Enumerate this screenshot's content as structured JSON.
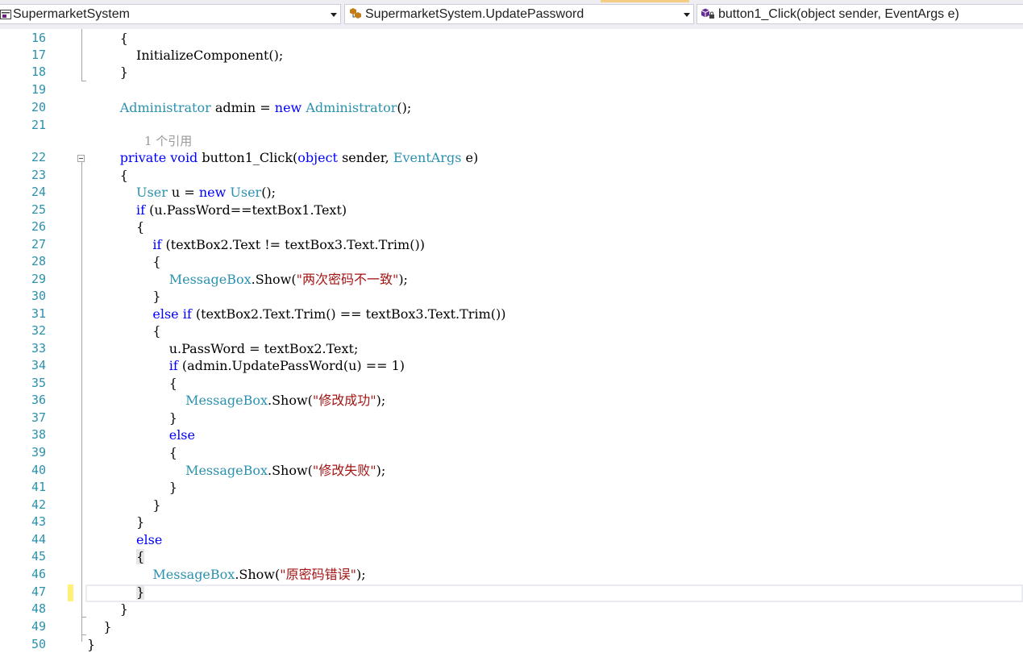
{
  "navbar": {
    "project": "SupermarketSystem",
    "class": "SupermarketSystem.UpdatePassword",
    "member": "button1_Click(object sender, EventArgs e)"
  },
  "icons": [
    "csharp-project-icon",
    "class-icon",
    "method-icon",
    "dropdown-arrow-icon"
  ],
  "colors": {
    "keyword": "#0000ff",
    "type": "#2b91af",
    "string": "#a31515",
    "line_number": "#2b91af",
    "code_lens": "#999999",
    "change_marker": "#fff176"
  },
  "code_lens": "1 个引用",
  "lines": [
    {
      "num": "16",
      "tokens": [
        {
          "t": "        {"
        }
      ]
    },
    {
      "num": "17",
      "tokens": [
        {
          "t": "            InitializeComponent();"
        }
      ]
    },
    {
      "num": "18",
      "tokens": [
        {
          "t": "        }"
        }
      ]
    },
    {
      "num": "19",
      "tokens": []
    },
    {
      "num": "20",
      "tokens": [
        {
          "t": "        "
        },
        {
          "t": "Administrator",
          "c": "ty"
        },
        {
          "t": " admin = "
        },
        {
          "t": "new",
          "c": "kw"
        },
        {
          "t": " "
        },
        {
          "t": "Administrator",
          "c": "ty"
        },
        {
          "t": "();"
        }
      ]
    },
    {
      "num": "21",
      "tokens": []
    },
    {
      "num": "22",
      "tokens": [
        {
          "t": "        "
        },
        {
          "t": "private",
          "c": "kw"
        },
        {
          "t": " "
        },
        {
          "t": "void",
          "c": "kw"
        },
        {
          "t": " button1_Click("
        },
        {
          "t": "object",
          "c": "kw"
        },
        {
          "t": " sender, "
        },
        {
          "t": "EventArgs",
          "c": "ty"
        },
        {
          "t": " e)"
        }
      ]
    },
    {
      "num": "23",
      "tokens": [
        {
          "t": "        {"
        }
      ]
    },
    {
      "num": "24",
      "tokens": [
        {
          "t": "            "
        },
        {
          "t": "User",
          "c": "ty"
        },
        {
          "t": " u = "
        },
        {
          "t": "new",
          "c": "kw"
        },
        {
          "t": " "
        },
        {
          "t": "User",
          "c": "ty"
        },
        {
          "t": "();"
        }
      ]
    },
    {
      "num": "25",
      "tokens": [
        {
          "t": "            "
        },
        {
          "t": "if",
          "c": "kw"
        },
        {
          "t": " (u.PassWord==textBox1.Text)"
        }
      ]
    },
    {
      "num": "26",
      "tokens": [
        {
          "t": "            {"
        }
      ]
    },
    {
      "num": "27",
      "tokens": [
        {
          "t": "                "
        },
        {
          "t": "if",
          "c": "kw"
        },
        {
          "t": " (textBox2.Text != textBox3.Text.Trim())"
        }
      ]
    },
    {
      "num": "28",
      "tokens": [
        {
          "t": "                {"
        }
      ]
    },
    {
      "num": "29",
      "tokens": [
        {
          "t": "                    "
        },
        {
          "t": "MessageBox",
          "c": "ty"
        },
        {
          "t": ".Show("
        },
        {
          "t": "\"两次密码不一致\"",
          "c": "st"
        },
        {
          "t": ");"
        }
      ]
    },
    {
      "num": "30",
      "tokens": [
        {
          "t": "                }"
        }
      ]
    },
    {
      "num": "31",
      "tokens": [
        {
          "t": "                "
        },
        {
          "t": "else",
          "c": "kw"
        },
        {
          "t": " "
        },
        {
          "t": "if",
          "c": "kw"
        },
        {
          "t": " (textBox2.Text.Trim() == textBox3.Text.Trim())"
        }
      ]
    },
    {
      "num": "32",
      "tokens": [
        {
          "t": "                {"
        }
      ]
    },
    {
      "num": "33",
      "tokens": [
        {
          "t": "                    u.PassWord = textBox2.Text;"
        }
      ]
    },
    {
      "num": "34",
      "tokens": [
        {
          "t": "                    "
        },
        {
          "t": "if",
          "c": "kw"
        },
        {
          "t": " (admin.UpdatePassWord(u) == 1)"
        }
      ]
    },
    {
      "num": "35",
      "tokens": [
        {
          "t": "                    {"
        }
      ]
    },
    {
      "num": "36",
      "tokens": [
        {
          "t": "                        "
        },
        {
          "t": "MessageBox",
          "c": "ty"
        },
        {
          "t": ".Show("
        },
        {
          "t": "\"修改成功\"",
          "c": "st"
        },
        {
          "t": ");"
        }
      ]
    },
    {
      "num": "37",
      "tokens": [
        {
          "t": "                    }"
        }
      ]
    },
    {
      "num": "38",
      "tokens": [
        {
          "t": "                    "
        },
        {
          "t": "else",
          "c": "kw"
        }
      ]
    },
    {
      "num": "39",
      "tokens": [
        {
          "t": "                    {"
        }
      ]
    },
    {
      "num": "40",
      "tokens": [
        {
          "t": "                        "
        },
        {
          "t": "MessageBox",
          "c": "ty"
        },
        {
          "t": ".Show("
        },
        {
          "t": "\"修改失败\"",
          "c": "st"
        },
        {
          "t": ");"
        }
      ]
    },
    {
      "num": "41",
      "tokens": [
        {
          "t": "                    }"
        }
      ]
    },
    {
      "num": "42",
      "tokens": [
        {
          "t": "                }"
        }
      ]
    },
    {
      "num": "43",
      "tokens": [
        {
          "t": "            }"
        }
      ]
    },
    {
      "num": "44",
      "tokens": [
        {
          "t": "            "
        },
        {
          "t": "else",
          "c": "kw"
        }
      ]
    },
    {
      "num": "45",
      "tokens": [
        {
          "t": "            "
        },
        {
          "t": "{",
          "c": "bh"
        }
      ]
    },
    {
      "num": "46",
      "tokens": [
        {
          "t": "                "
        },
        {
          "t": "MessageBox",
          "c": "ty"
        },
        {
          "t": ".Show("
        },
        {
          "t": "\"原密码错误\"",
          "c": "st"
        },
        {
          "t": ");"
        }
      ]
    },
    {
      "num": "47",
      "tokens": [
        {
          "t": "            "
        },
        {
          "t": "}",
          "c": "bh"
        }
      ]
    },
    {
      "num": "48",
      "tokens": [
        {
          "t": "        }"
        }
      ]
    },
    {
      "num": "49",
      "tokens": [
        {
          "t": "    }"
        }
      ]
    },
    {
      "num": "50",
      "tokens": [
        {
          "t": "}"
        }
      ]
    }
  ]
}
